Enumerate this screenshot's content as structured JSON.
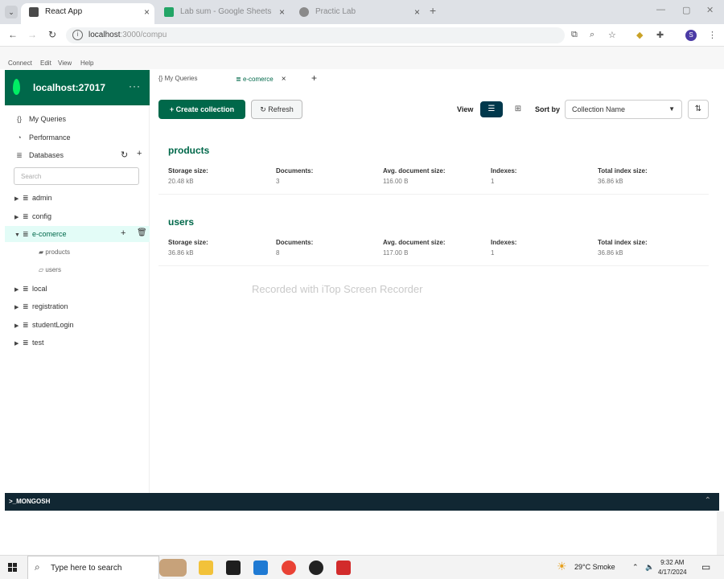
{
  "browser": {
    "tabs": [
      {
        "title": "React App",
        "active": true
      },
      {
        "title": "Lab sum - Google Sheets",
        "active": false
      },
      {
        "title": "Practic Lab",
        "active": false
      }
    ],
    "url_host": "localhost",
    "url_rest": ":3000/compu"
  },
  "app": {
    "menu": [
      "Connect",
      "Edit",
      "View",
      "Help"
    ],
    "connection_host": "localhost:27017",
    "sidebar": {
      "my_queries": "My Queries",
      "performance": "Performance",
      "databases": "Databases",
      "search_placeholder": "Search",
      "databases_list": [
        "admin",
        "config",
        "e-comerce",
        "local",
        "registration",
        "studentLogin",
        "test"
      ],
      "collections": [
        "products",
        "users"
      ]
    },
    "workspace_tabs": [
      "My Queries",
      "e-comerce"
    ],
    "toolbar": {
      "create_collection": "Create collection",
      "refresh": "Refresh",
      "view_label": "View",
      "sort_label": "Sort by",
      "sort_value": "Collection Name"
    },
    "stat_labels": [
      "Storage size:",
      "Documents:",
      "Avg. document size:",
      "Indexes:",
      "Total index size:"
    ],
    "cards": [
      {
        "name": "products",
        "values": [
          "20.48 kB",
          "3",
          "116.00 B",
          "1",
          "36.86 kB"
        ]
      },
      {
        "name": "users",
        "values": [
          "36.86 kB",
          "8",
          "117.00 B",
          "1",
          "36.86 kB"
        ]
      }
    ],
    "watermark": "Recorded with iTop Screen Recorder",
    "shell_label": ">_MONGOSH"
  },
  "taskbar": {
    "search_placeholder": "Type here to search",
    "weather": "29°C  Smoke",
    "time": "9:32 AM",
    "date": "4/17/2024"
  },
  "colors": {
    "brand_green": "#00684a",
    "leaf_green": "#00ed64",
    "shell_bg": "#112733"
  }
}
